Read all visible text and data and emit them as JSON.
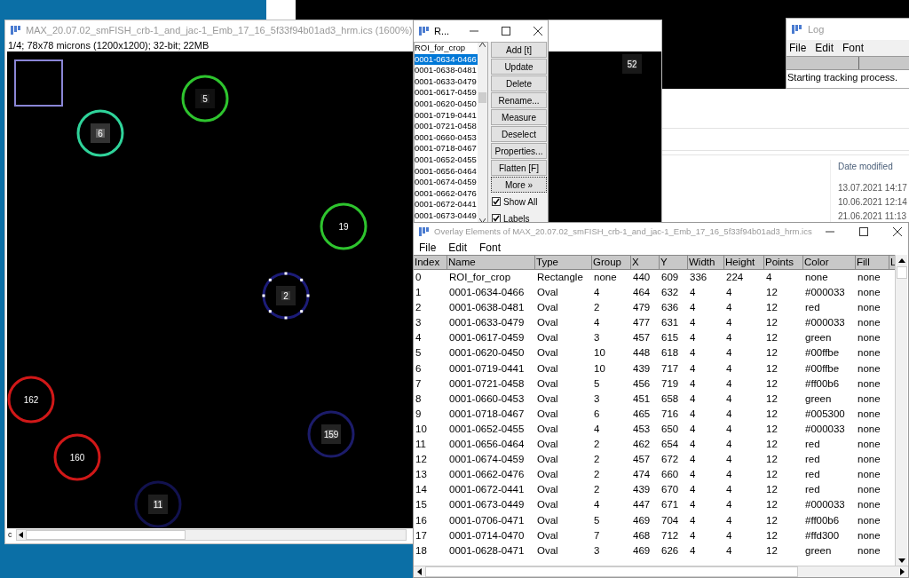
{
  "image_window": {
    "title": "MAX_20.07.02_smFISH_crb-1_and_jac-1_Emb_17_16_5f33f94b01ad3_hrm.ics (1600%)",
    "info": "1/4; 78x78 microns (1200x1200); 32-bit; 22MB",
    "rois": [
      {
        "kind": "rectangle",
        "color": "#8a86d6",
        "selected": false
      },
      {
        "kind": "circle",
        "label": "5",
        "color": "#2ec42e",
        "selected": false
      },
      {
        "kind": "circle",
        "label": "6",
        "color": "#2fd39a",
        "selected": false
      },
      {
        "kind": "circle",
        "label": "19",
        "color": "#2ec42e",
        "selected": false
      },
      {
        "kind": "circle",
        "label": "2",
        "color": "#1c1c78",
        "selected": true
      },
      {
        "kind": "circle",
        "label": "162",
        "color": "#d01818",
        "selected": false
      },
      {
        "kind": "circle",
        "label": "160",
        "color": "#d01818",
        "selected": false
      },
      {
        "kind": "circle",
        "label": "159",
        "color": "#1c1c6a",
        "selected": false
      },
      {
        "kind": "circle",
        "label": "11",
        "color": "#12124f",
        "selected": false
      },
      {
        "kind": "label",
        "label": "52",
        "selected": false
      }
    ],
    "slider_label": "c"
  },
  "roi_manager": {
    "title": "R...",
    "items": [
      {
        "name": "ROI_for_crop",
        "selected": false
      },
      {
        "name": "0001-0634-0466",
        "selected": true
      },
      {
        "name": "0001-0638-0481",
        "selected": false
      },
      {
        "name": "0001-0633-0479",
        "selected": false
      },
      {
        "name": "0001-0617-0459",
        "selected": false
      },
      {
        "name": "0001-0620-0450",
        "selected": false
      },
      {
        "name": "0001-0719-0441",
        "selected": false
      },
      {
        "name": "0001-0721-0458",
        "selected": false
      },
      {
        "name": "0001-0660-0453",
        "selected": false
      },
      {
        "name": "0001-0718-0467",
        "selected": false
      },
      {
        "name": "0001-0652-0455",
        "selected": false
      },
      {
        "name": "0001-0656-0464",
        "selected": false
      },
      {
        "name": "0001-0674-0459",
        "selected": false
      },
      {
        "name": "0001-0662-0476",
        "selected": false
      },
      {
        "name": "0001-0672-0441",
        "selected": false
      },
      {
        "name": "0001-0673-0449",
        "selected": false
      }
    ],
    "buttons": [
      {
        "label": "Add [t]",
        "focused": false
      },
      {
        "label": "Update",
        "focused": false
      },
      {
        "label": "Delete",
        "focused": false
      },
      {
        "label": "Rename...",
        "focused": false
      },
      {
        "label": "Measure",
        "focused": false
      },
      {
        "label": "Deselect",
        "focused": false
      },
      {
        "label": "Properties...",
        "focused": false
      },
      {
        "label": "Flatten [F]",
        "focused": false
      },
      {
        "label": "More »",
        "focused": true
      }
    ],
    "checkboxes": [
      {
        "label": "Show All",
        "checked": true
      },
      {
        "label": "Labels",
        "checked": true
      }
    ]
  },
  "log_window": {
    "title": "Log",
    "menu": [
      "File",
      "Edit",
      "Font"
    ],
    "lines": [
      "Starting tracking process."
    ]
  },
  "file_explorer": {
    "column_header": "Date modified",
    "dates": [
      "13.07.2021 14:17",
      "10.06.2021 12:14",
      "21.06.2021 11:13"
    ]
  },
  "overlay_window": {
    "title": "Overlay Elements of MAX_20.07.02_smFISH_crb-1_and_jac-1_Emb_17_16_5f33f94b01ad3_hrm.ics",
    "menu": [
      "File",
      "Edit",
      "Font"
    ],
    "columns": [
      "Index",
      "Name",
      "Type",
      "Group",
      "X",
      "Y",
      "Width",
      "Height",
      "Points",
      "Color",
      "Fill",
      "L"
    ],
    "rows": [
      [
        "0",
        "ROI_for_crop",
        "Rectangle",
        "none",
        "440",
        "609",
        "336",
        "224",
        "4",
        "none",
        "none"
      ],
      [
        "1",
        "0001-0634-0466",
        "Oval",
        "4",
        "464",
        "632",
        "4",
        "4",
        "12",
        "#000033",
        "none"
      ],
      [
        "2",
        "0001-0638-0481",
        "Oval",
        "2",
        "479",
        "636",
        "4",
        "4",
        "12",
        "red",
        "none"
      ],
      [
        "3",
        "0001-0633-0479",
        "Oval",
        "4",
        "477",
        "631",
        "4",
        "4",
        "12",
        "#000033",
        "none"
      ],
      [
        "4",
        "0001-0617-0459",
        "Oval",
        "3",
        "457",
        "615",
        "4",
        "4",
        "12",
        "green",
        "none"
      ],
      [
        "5",
        "0001-0620-0450",
        "Oval",
        "10",
        "448",
        "618",
        "4",
        "4",
        "12",
        "#00ffbe",
        "none"
      ],
      [
        "6",
        "0001-0719-0441",
        "Oval",
        "10",
        "439",
        "717",
        "4",
        "4",
        "12",
        "#00ffbe",
        "none"
      ],
      [
        "7",
        "0001-0721-0458",
        "Oval",
        "5",
        "456",
        "719",
        "4",
        "4",
        "12",
        "#ff00b6",
        "none"
      ],
      [
        "8",
        "0001-0660-0453",
        "Oval",
        "3",
        "451",
        "658",
        "4",
        "4",
        "12",
        "green",
        "none"
      ],
      [
        "9",
        "0001-0718-0467",
        "Oval",
        "6",
        "465",
        "716",
        "4",
        "4",
        "12",
        "#005300",
        "none"
      ],
      [
        "10",
        "0001-0652-0455",
        "Oval",
        "4",
        "453",
        "650",
        "4",
        "4",
        "12",
        "#000033",
        "none"
      ],
      [
        "11",
        "0001-0656-0464",
        "Oval",
        "2",
        "462",
        "654",
        "4",
        "4",
        "12",
        "red",
        "none"
      ],
      [
        "12",
        "0001-0674-0459",
        "Oval",
        "2",
        "457",
        "672",
        "4",
        "4",
        "12",
        "red",
        "none"
      ],
      [
        "13",
        "0001-0662-0476",
        "Oval",
        "2",
        "474",
        "660",
        "4",
        "4",
        "12",
        "red",
        "none"
      ],
      [
        "14",
        "0001-0672-0441",
        "Oval",
        "2",
        "439",
        "670",
        "4",
        "4",
        "12",
        "red",
        "none"
      ],
      [
        "15",
        "0001-0673-0449",
        "Oval",
        "4",
        "447",
        "671",
        "4",
        "4",
        "12",
        "#000033",
        "none"
      ],
      [
        "16",
        "0001-0706-0471",
        "Oval",
        "5",
        "469",
        "704",
        "4",
        "4",
        "12",
        "#ff00b6",
        "none"
      ],
      [
        "17",
        "0001-0714-0470",
        "Oval",
        "7",
        "468",
        "712",
        "4",
        "4",
        "12",
        "#ffd300",
        "none"
      ],
      [
        "18",
        "0001-0628-0471",
        "Oval",
        "3",
        "469",
        "626",
        "4",
        "4",
        "12",
        "green",
        "none"
      ]
    ]
  }
}
